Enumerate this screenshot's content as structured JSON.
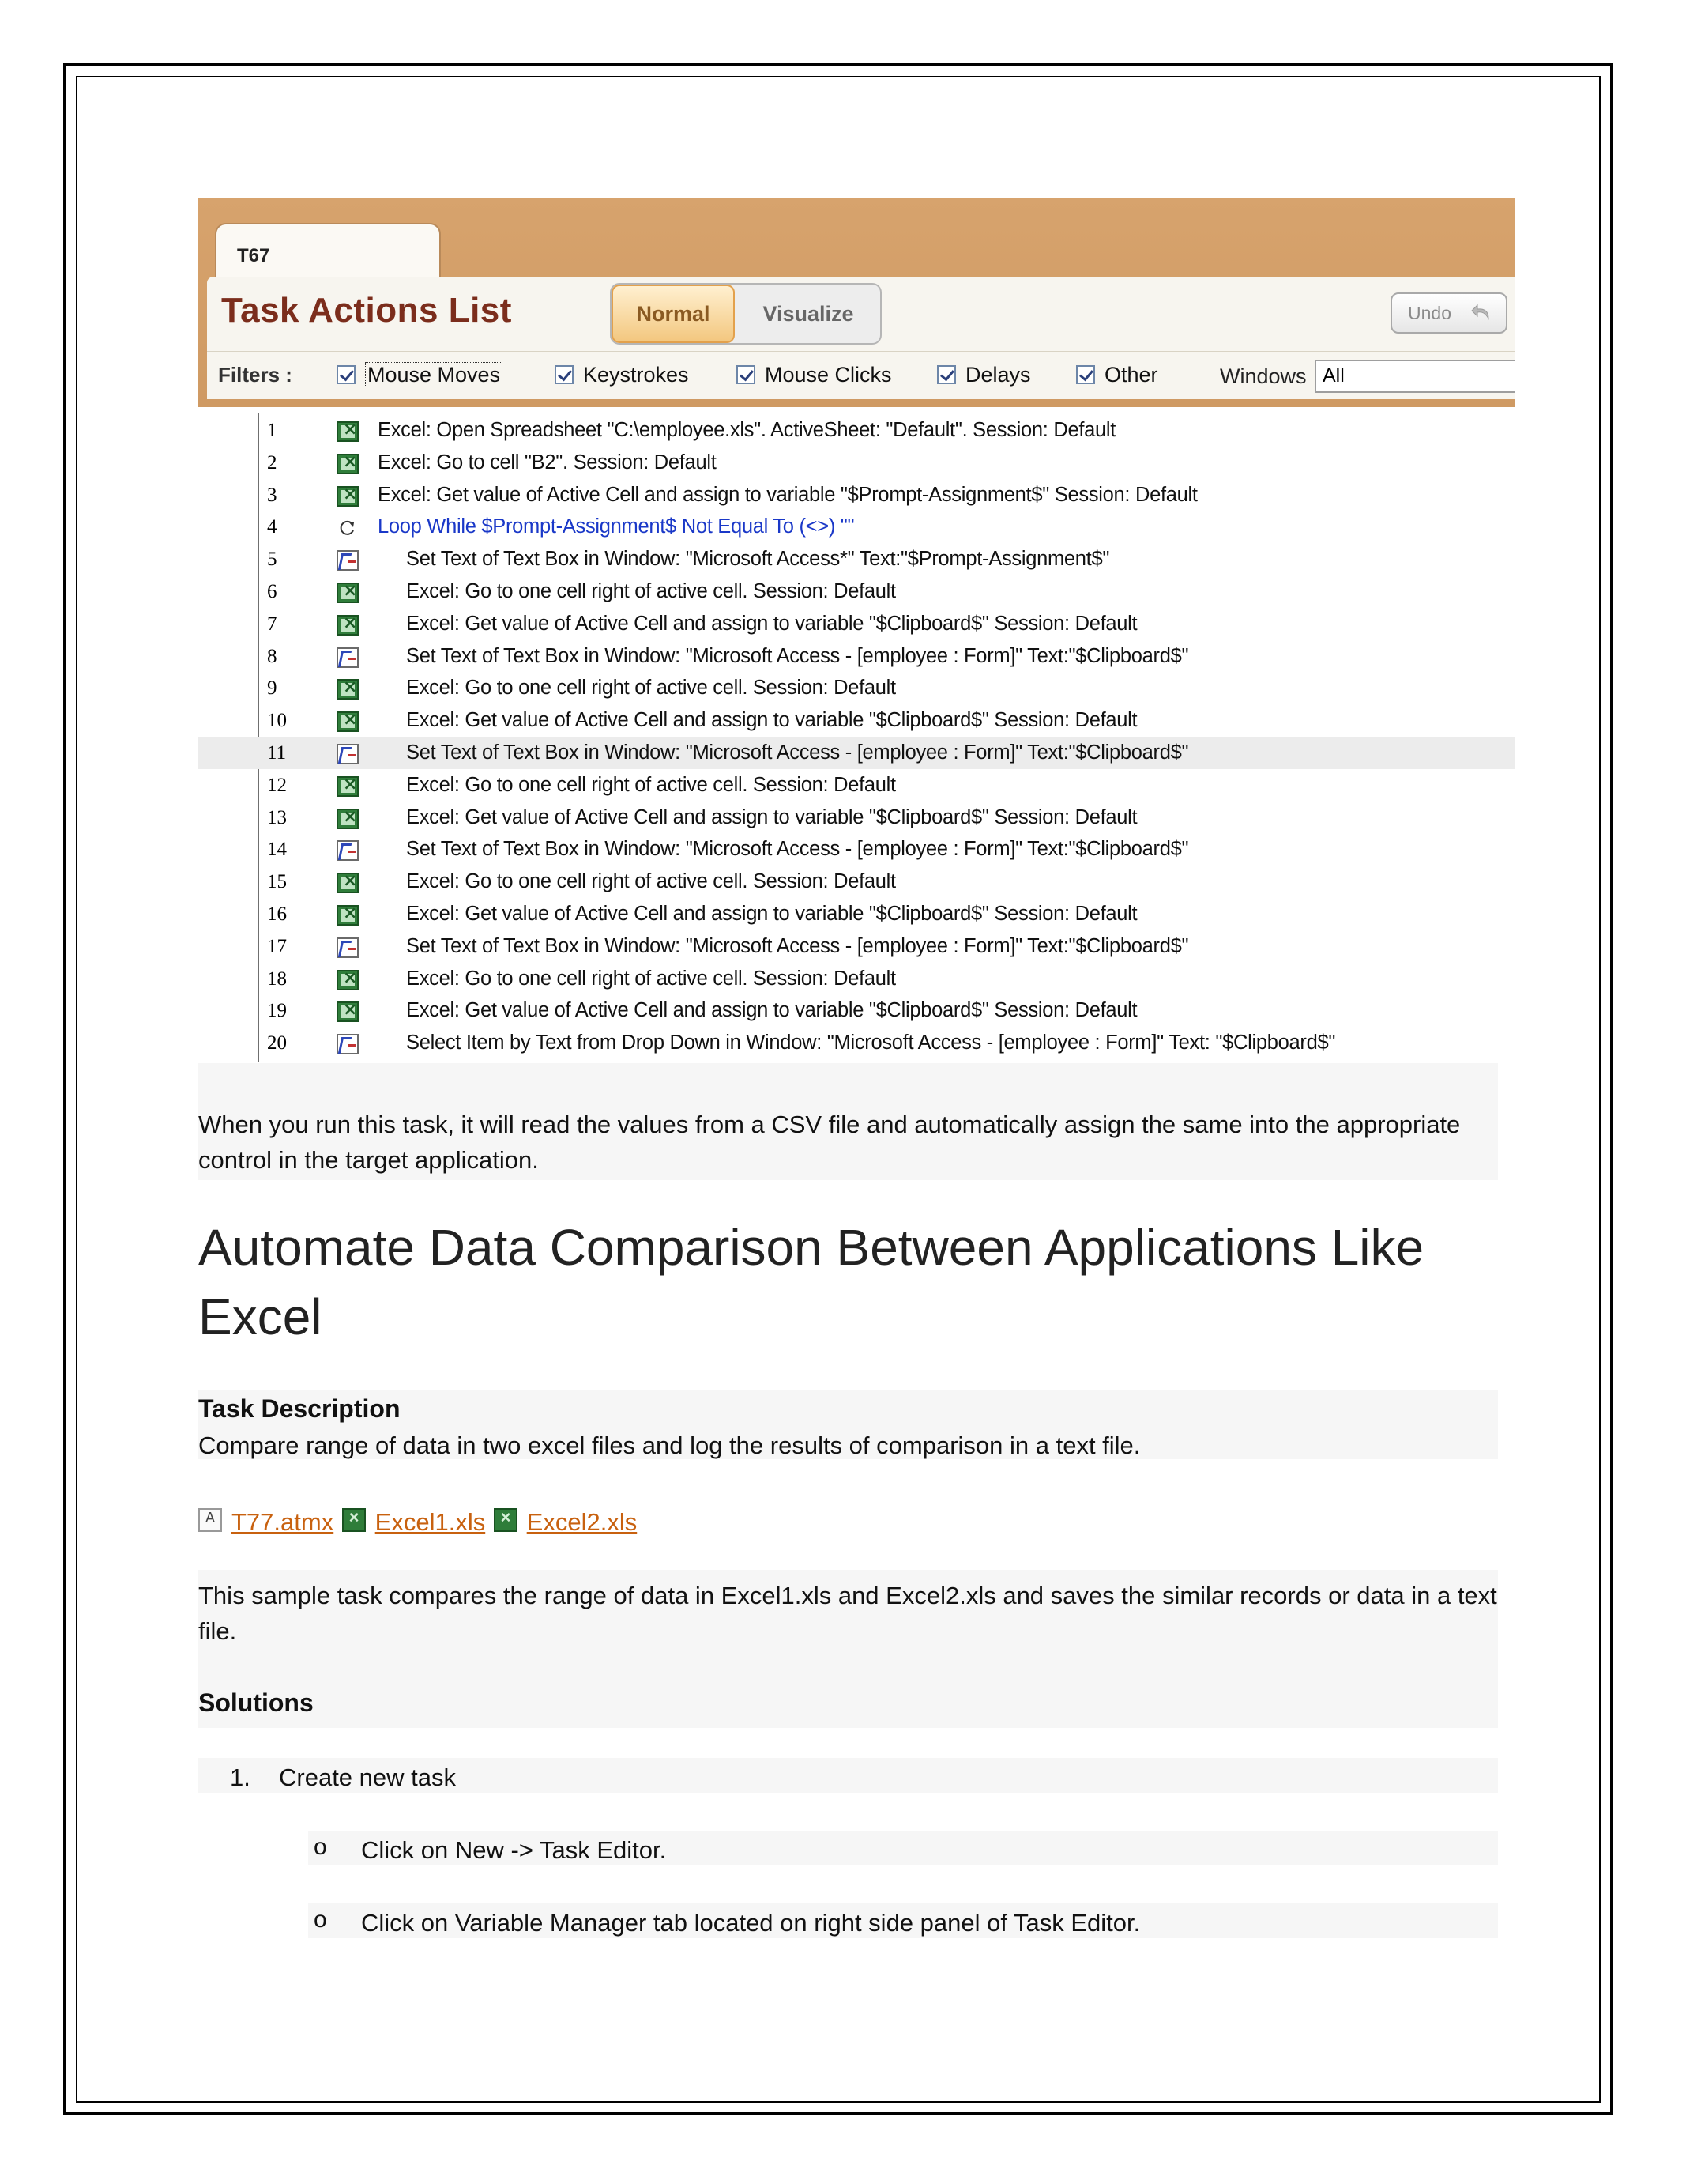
{
  "screenshot": {
    "tab_label": "T67",
    "title": "Task Actions List",
    "toggle": {
      "normal": "Normal",
      "visualize": "Visualize"
    },
    "undo_label": "Undo",
    "filters_label": "Filters :",
    "filters": [
      "Mouse Moves",
      "Keystrokes",
      "Mouse Clicks",
      "Delays",
      "Other"
    ],
    "windows_label": "Windows",
    "windows_value": "All",
    "actions": [
      {
        "n": "1",
        "icon": "excel",
        "text": "Excel: Open Spreadsheet \"C:\\employee.xls\". ActiveSheet: \"Default\". Session: Default"
      },
      {
        "n": "2",
        "icon": "excel",
        "text": "Excel: Go to cell \"B2\". Session: Default"
      },
      {
        "n": "3",
        "icon": "excel",
        "text": "Excel: Get value of Active Cell and assign to variable \"$Prompt-Assignment$\" Session: Default"
      },
      {
        "n": "4",
        "icon": "loop",
        "text": "Loop While $Prompt-Assignment$ Not Equal To (<>) \"\""
      },
      {
        "n": "5",
        "icon": "window",
        "text": "Set Text of Text Box in Window: \"Microsoft Access*\" Text:\"$Prompt-Assignment$\""
      },
      {
        "n": "6",
        "icon": "excel",
        "text": "Excel: Go to one cell right of active cell. Session: Default"
      },
      {
        "n": "7",
        "icon": "excel",
        "text": "Excel: Get value of Active Cell and assign to variable \"$Clipboard$\" Session: Default"
      },
      {
        "n": "8",
        "icon": "window",
        "text": "Set Text of Text Box in Window: \"Microsoft Access - [employee : Form]\" Text:\"$Clipboard$\""
      },
      {
        "n": "9",
        "icon": "excel",
        "text": "Excel: Go to one cell right of active cell. Session: Default"
      },
      {
        "n": "10",
        "icon": "excel",
        "text": "Excel: Get value of Active Cell and assign to variable \"$Clipboard$\" Session: Default"
      },
      {
        "n": "11",
        "icon": "window",
        "text": "Set Text of Text Box in Window: \"Microsoft Access - [employee : Form]\" Text:\"$Clipboard$\""
      },
      {
        "n": "12",
        "icon": "excel",
        "text": "Excel: Go to one cell right of active cell. Session: Default"
      },
      {
        "n": "13",
        "icon": "excel",
        "text": "Excel: Get value of Active Cell and assign to variable \"$Clipboard$\" Session: Default"
      },
      {
        "n": "14",
        "icon": "window",
        "text": "Set Text of Text Box in Window: \"Microsoft Access - [employee : Form]\" Text:\"$Clipboard$\""
      },
      {
        "n": "15",
        "icon": "excel",
        "text": "Excel: Go to one cell right of active cell. Session: Default"
      },
      {
        "n": "16",
        "icon": "excel",
        "text": "Excel: Get value of Active Cell and assign to variable \"$Clipboard$\" Session: Default"
      },
      {
        "n": "17",
        "icon": "window",
        "text": "Set Text of Text Box in Window: \"Microsoft Access - [employee : Form]\" Text:\"$Clipboard$\""
      },
      {
        "n": "18",
        "icon": "excel",
        "text": "Excel: Go to one cell right of active cell. Session: Default"
      },
      {
        "n": "19",
        "icon": "excel",
        "text": "Excel: Get value of Active Cell and assign to variable \"$Clipboard$\" Session: Default"
      },
      {
        "n": "20",
        "icon": "window",
        "text": "Select Item by Text from Drop Down in Window: \"Microsoft Access - [employee : Form]\" Text: \"$Clipboard$\""
      }
    ]
  },
  "doc": {
    "intro_paragraph": "When you run this task, it will read the values from a CSV file and automatically assign the same into the appropriate control in the target application.",
    "heading": "Automate Data Comparison Between Applications Like Excel",
    "task_description_heading": "Task Description",
    "task_description": "Compare range of data in two excel files and log the results of comparison in a text file.",
    "attachments": [
      "T77.atmx",
      "Excel1.xls",
      "Excel2.xls"
    ],
    "sample_paragraph": "This sample task compares the range of data in Excel1.xls and Excel2.xls and saves the similar records or data in a text file.",
    "solutions_heading": "Solutions",
    "step1_number": "1.",
    "step1": "Create new task",
    "bullet_marker": "o",
    "sub_steps": [
      "Click on New -> Task Editor.",
      "Click on Variable Manager tab located on right side panel of Task Editor."
    ]
  }
}
